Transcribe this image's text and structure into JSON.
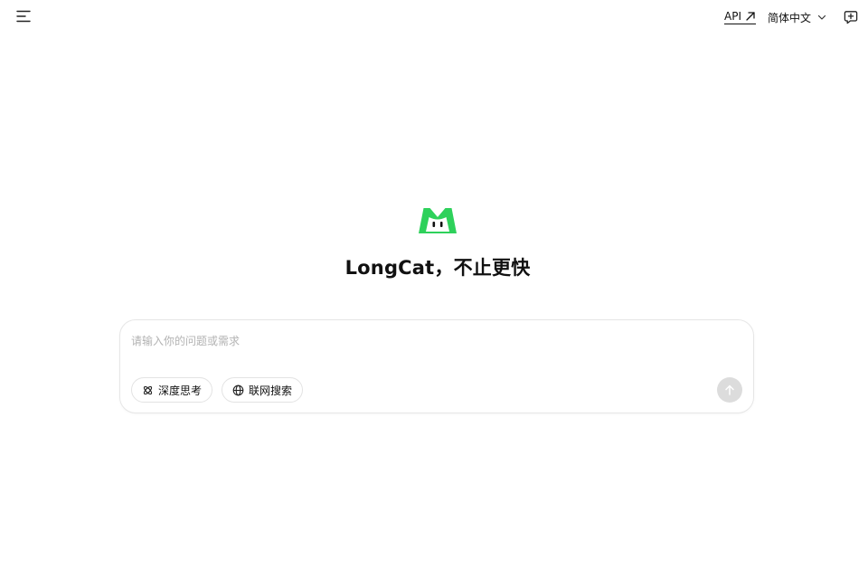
{
  "header": {
    "api_label": "API",
    "language_label": "简体中文"
  },
  "hero": {
    "title": "LongCat，不止更快",
    "brand_color": "#2ed15b"
  },
  "chat": {
    "placeholder": "请输入你的问题或需求",
    "value": "",
    "chips": {
      "deep_think_label": "深度思考",
      "web_search_label": "联网搜索"
    }
  },
  "icons": {
    "menu": "menu-icon",
    "api_arrow": "arrow-up-right-icon",
    "language_chevron": "chevron-down-icon",
    "new_chat": "new-chat-icon",
    "deep_think": "atom-icon",
    "web_search": "globe-icon",
    "send": "arrow-up-icon"
  }
}
